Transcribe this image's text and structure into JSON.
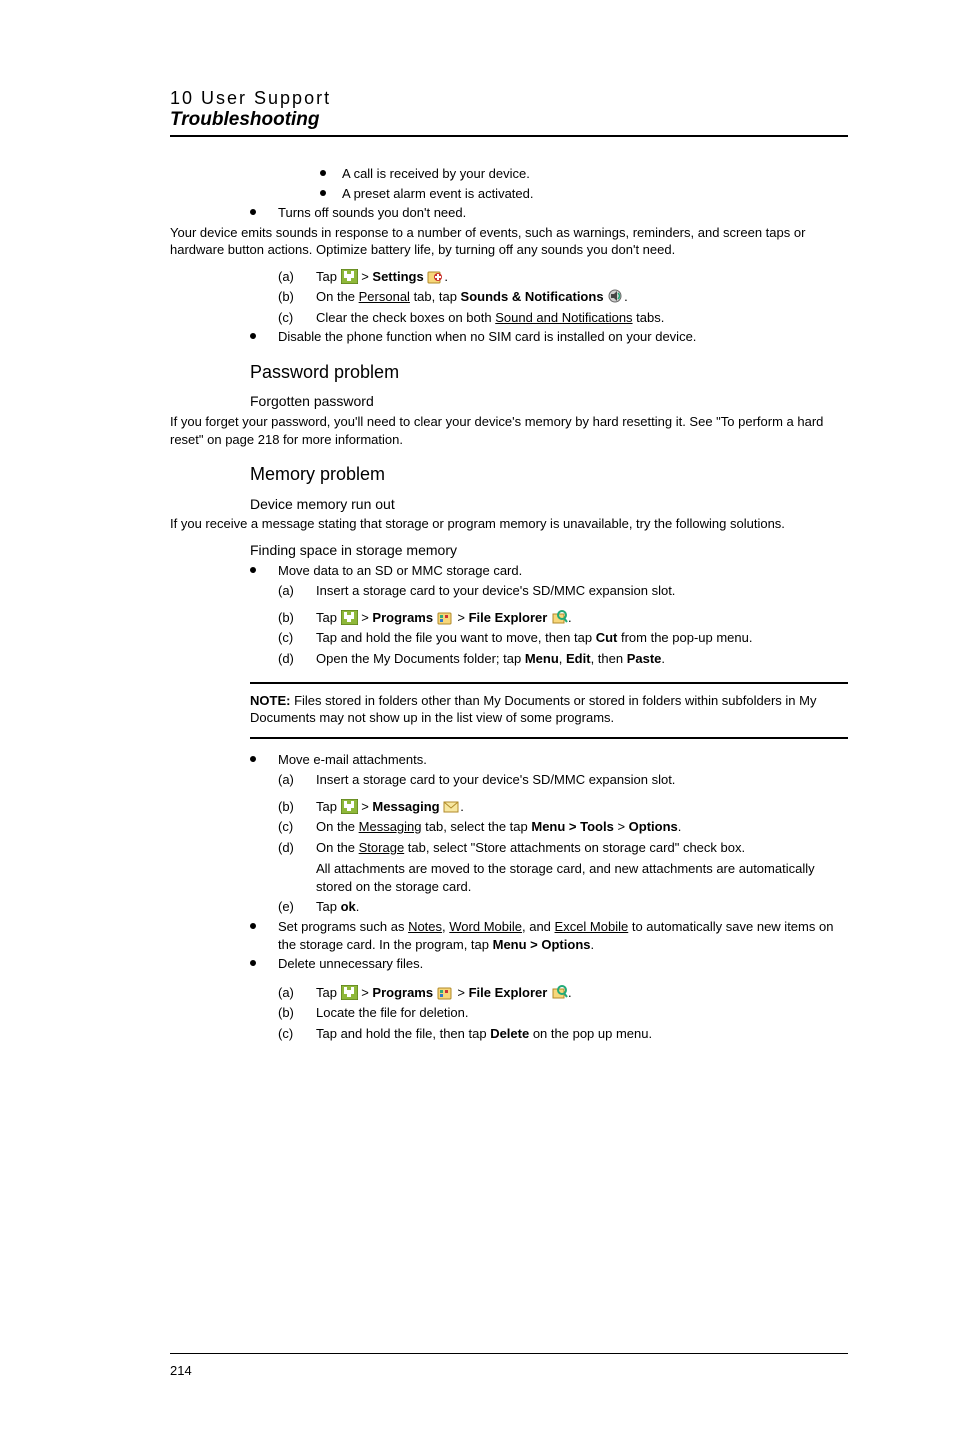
{
  "header": {
    "chapter": "10 User Support",
    "section": "Troubleshooting"
  },
  "sub_bullets_top": [
    "A call is received by your device.",
    "A preset alarm event is activated."
  ],
  "b_turns_off": "Turns off sounds you don't need.",
  "p_turns_off_body": "Your device emits sounds in response to a number of events, such as warnings, reminders, and screen taps or hardware button actions. Optimize battery life, by turning off any sounds you don't need.",
  "steps_sounds": {
    "a": {
      "label": "(a)",
      "pre": "Tap ",
      "post": " > ",
      "bold": "Settings",
      "tail": " ",
      "dot": "."
    },
    "b": {
      "label": "(b)",
      "pre": "On the ",
      "u": "Personal",
      "mid": " tab, tap ",
      "bold": "Sounds & Notifications",
      "tail": " ",
      "dot": "."
    },
    "c": {
      "label": "(c)",
      "pre": "Clear the check boxes on both ",
      "u": "Sound and Notifications",
      "tail": " tabs."
    }
  },
  "b_disable_phone": "Disable the phone function when no SIM card is installed on your device.",
  "h3_password": "Password problem",
  "h4_forgotten": "Forgotten password",
  "p_forgotten": "If you forget your password, you'll need to clear your device's memory by hard resetting it. See \"To perform a hard reset\" on page 218 for more information.",
  "h3_memory": "Memory problem",
  "h4_device_mem": "Device memory run out",
  "p_device_mem": "If you receive a message stating that storage or program memory is unavailable, try the following solutions.",
  "h4_finding": "Finding space in storage memory",
  "b_move_sd": "Move data to an SD or MMC storage card.",
  "steps_move_sd": {
    "a": {
      "label": "(a)",
      "text": "Insert a storage card to your device's SD/MMC expansion slot."
    },
    "b": {
      "label": "(b)",
      "pre": "Tap ",
      "mid1": " > ",
      "bold1": "Programs",
      "mid2": " ",
      "mid3": " > ",
      "bold2": "File Explorer",
      "tail": " ",
      "dot": "."
    },
    "c": {
      "label": "(c)",
      "pre": "Tap and hold the file you want to move, then tap ",
      "bold": "Cut",
      "tail": " from the pop-up menu."
    },
    "d": {
      "label": "(d)",
      "pre": "Open the My Documents folder; tap ",
      "b1": "Menu",
      "s1": ", ",
      "b2": "Edit",
      "s2": ", then ",
      "b3": "Paste",
      "dot": "."
    }
  },
  "note": {
    "label": "NOTE:",
    "body": "   Files stored in folders other than My Documents or stored in folders within subfolders in My Documents may not show up in the list view of some programs."
  },
  "b_move_email": "Move e-mail attachments.",
  "steps_email": {
    "a": {
      "label": "(a)",
      "text": "Insert a storage card to your device's SD/MMC expansion slot."
    },
    "b": {
      "label": "(b)",
      "pre": "Tap ",
      "mid": " > ",
      "bold": "Messaging",
      "tail": " ",
      "dot": "."
    },
    "c": {
      "label": "(c)",
      "pre": "On the ",
      "u": "Messaging",
      "mid": " tab, select the tap ",
      "b1": "Menu > Tools",
      "s1": " > ",
      "b2": "Options",
      "dot": "."
    },
    "d": {
      "label": "(d)",
      "pre": "On the ",
      "u": "Storage",
      "tail": " tab, select \"Store attachments on storage card\" check box."
    },
    "d_body": "All attachments are moved to the storage card, and new attachments are automatically stored on the storage card.",
    "e": {
      "label": "(e)",
      "pre": "Tap ",
      "bold": "ok",
      "dot": "."
    }
  },
  "b_set_programs": {
    "pre": "Set programs such as ",
    "u1": "Notes",
    "s1": ", ",
    "u2": "Word Mobile",
    "s2": ", and ",
    "u3": "Excel Mobile",
    "mid": " to automatically save new items on the storage card. In the program, tap ",
    "bold": "Menu > Options",
    "dot": "."
  },
  "b_delete": "Delete unnecessary files.",
  "steps_delete": {
    "a": {
      "label": "(a)",
      "pre": "Tap ",
      "mid1": " > ",
      "bold1": "Programs",
      "mid2": " ",
      "mid3": " > ",
      "bold2": "File Explorer",
      "tail": " ",
      "dot": "."
    },
    "b": {
      "label": "(b)",
      "text": "Locate the file for deletion."
    },
    "c": {
      "label": "(c)",
      "pre": "Tap and hold the file, then tap ",
      "bold": "Delete",
      "tail": " on the pop up menu."
    }
  },
  "page_number": "214"
}
